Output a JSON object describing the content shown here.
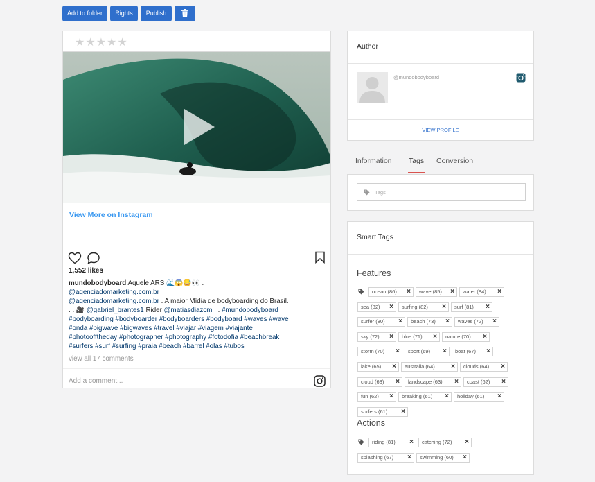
{
  "toolbar": {
    "add_to_folder": "Add to folder",
    "rights": "Rights",
    "publish": "Publish",
    "delete_icon": "trash-icon"
  },
  "rating": {
    "value": 0,
    "max": 5
  },
  "instagram_post": {
    "view_more": "View More on Instagram",
    "likes": "1,552 likes",
    "caption_lines": [
      {
        "user": "mundobodyboard",
        "text": " Aquele ARS 🌊😱😅👀 ."
      },
      {
        "link": "@agenciadomarketing.com.br",
        "text": " @agenciadomarketing.com.br"
      },
      {
        "link": "@agenciadomarketing.com.br",
        "text": " . A maior Mídia de bodyboarding do Brasil."
      },
      {
        "pre": ". . 🎥 ",
        "link": "@gabriel_brantes1",
        "text": " Rider ",
        "link2": "@matiasdiazcm",
        "text2": " . . ",
        "link3": "#mundobodyboard"
      },
      {
        "link": "#bodyboarding #bodyboarder #bodyboarders #bodyboard #waves #wave"
      },
      {
        "link": "#onda #bigwave #bigwaves #travel #viajar #viagem #viajante"
      },
      {
        "link": "#photoofftheday #photographer #photography #fotodofia #beachbreak"
      },
      {
        "link": "#surfers #surf #surfing #praia #beach #barrel #olas #tubos"
      }
    ],
    "view_all": "view all 17 comments",
    "add_comment": "Add a comment..."
  },
  "author": {
    "title": "Author",
    "handle": "@mundobodyboard",
    "view_profile": "VIEW PROFILE"
  },
  "tabs": [
    {
      "label": "Information",
      "active": false
    },
    {
      "label": "Tags",
      "active": true
    },
    {
      "label": "Conversion",
      "active": false
    }
  ],
  "tags_input": {
    "placeholder": "Tags"
  },
  "smart_tags": {
    "title": "Smart Tags",
    "features_title": "Features",
    "features": [
      "ocean (86)",
      "wave (85)",
      "water (84)",
      "sea (82)",
      "surfing (82)",
      "surf (81)",
      "surfer (80)",
      "beach (73)",
      "waves (72)",
      "sky (72)",
      "blue (71)",
      "nature (70)",
      "storm (70)",
      "sport (69)",
      "boat (67)",
      "lake (65)",
      "australia (64)",
      "clouds (64)",
      "cloud (63)",
      "landscape (63)",
      "coast (62)",
      "fun (62)",
      "breaking (61)",
      "holiday (61)",
      "surfers (61)"
    ],
    "actions_title": "Actions",
    "actions": [
      "riding (81)",
      "catching (72)",
      "splashing (67)",
      "swimming (60)"
    ]
  },
  "colors": {
    "accent": "#2f6fcc",
    "tab_active": "#d9534f"
  }
}
